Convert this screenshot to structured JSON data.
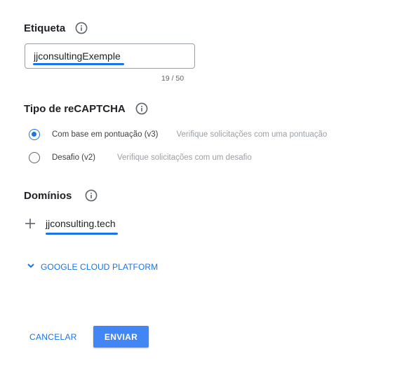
{
  "label_section": {
    "title": "Etiqueta",
    "input_value": "jjconsultingExemple",
    "counter": "19 / 50"
  },
  "recaptcha_section": {
    "title": "Tipo de reCAPTCHA",
    "options": [
      {
        "label": "Com base em pontuação (v3)",
        "description": "Verifique solicitações com uma pontuação",
        "selected": true
      },
      {
        "label": "Desafio (v2)",
        "description": "Verifique solicitações com um desafio",
        "selected": false
      }
    ]
  },
  "domains_section": {
    "title": "Domínios",
    "domain": "jjconsulting.tech"
  },
  "gcp_toggle": {
    "label": "GOOGLE CLOUD PLATFORM",
    "icon": "chevron-down-icon"
  },
  "actions": {
    "cancel_label": "CANCELAR",
    "submit_label": "ENVIAR"
  },
  "colors": {
    "accent": "#1a73e8",
    "primary_button": "#4285f4",
    "muted_text": "#9aa0a6"
  }
}
